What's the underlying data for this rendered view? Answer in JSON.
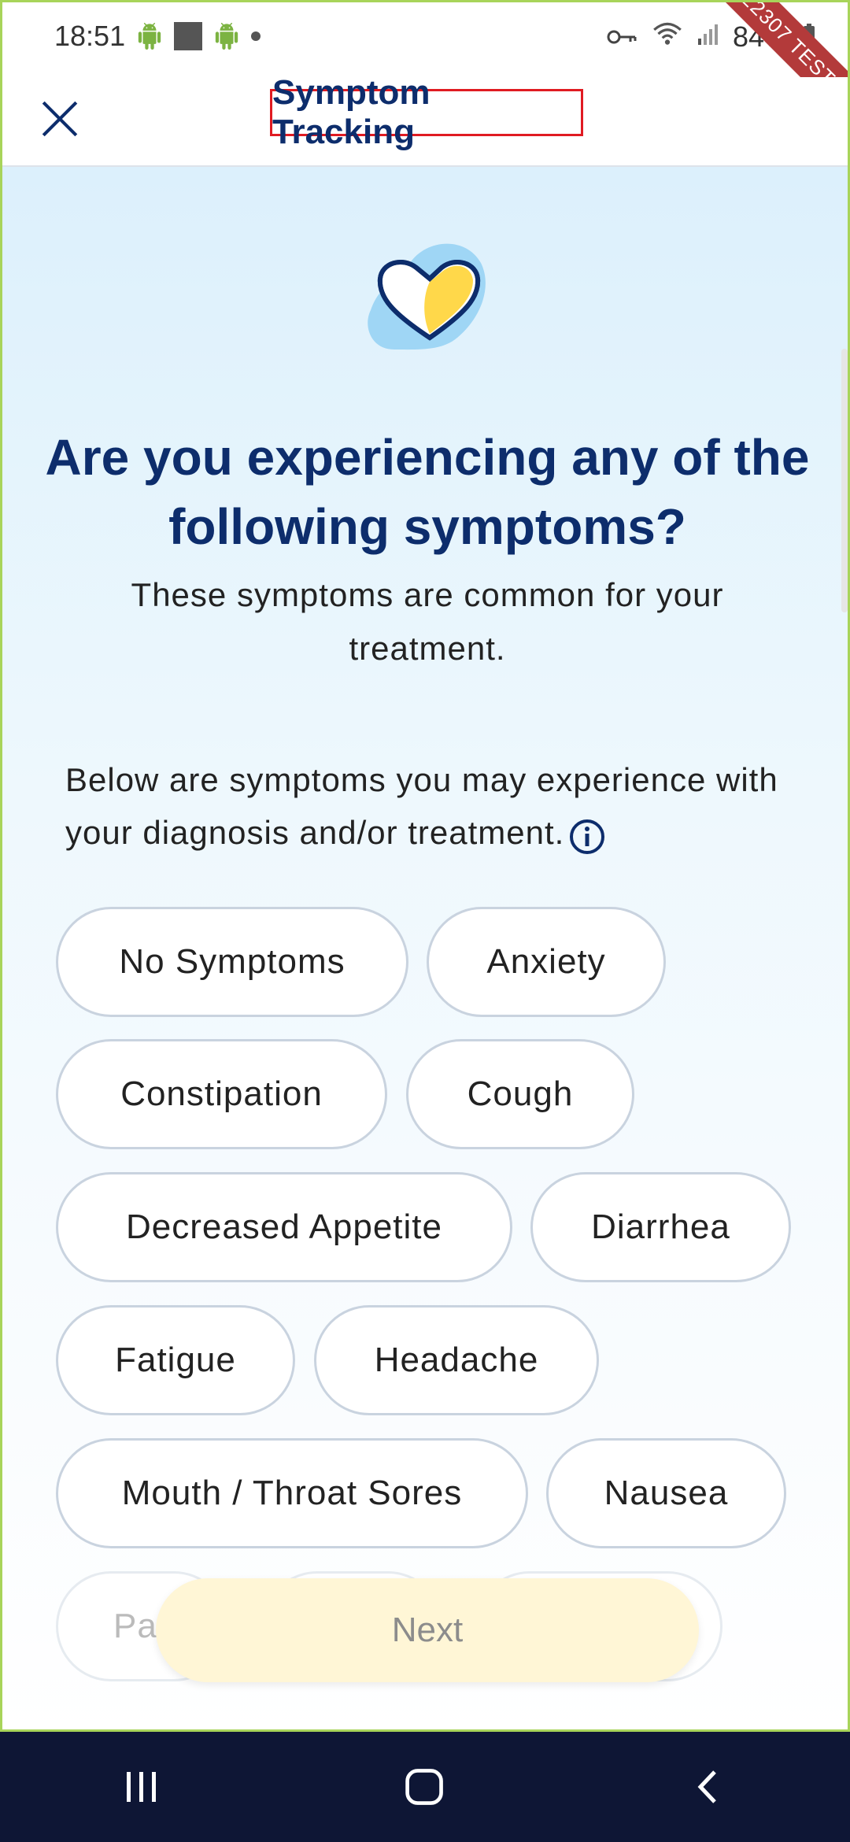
{
  "status_bar": {
    "time": "18:51",
    "battery": "84%",
    "icons": [
      "android-icon",
      "square-icon",
      "android-icon",
      "dot-icon",
      "key-icon",
      "wifi-icon",
      "signal-icon",
      "battery-icon"
    ]
  },
  "debug_banner": "22307 TEST",
  "header": {
    "title": "Symptom Tracking",
    "close_icon": "close-icon"
  },
  "main": {
    "hero_icon": "heart-icon",
    "title": "Are you experiencing any of the following symptoms?",
    "subtitle": "These symptoms are common for your treatment.",
    "intro": "Below are symptoms you may experience with your diagnosis and/or treatment.",
    "info_icon": "info-icon",
    "chips": [
      "No Symptoms",
      "Anxiety",
      "Constipation",
      "Cough",
      "Decreased Appetite",
      "Diarrhea",
      "Fatigue",
      "Headache",
      "Mouth / Throat Sores",
      "Nausea",
      "Pai"
    ]
  },
  "next_button": "Next",
  "colors": {
    "title": "#0d2d6c",
    "chip_border": "#c9d3df",
    "next_bg": "#fff6d6",
    "nav_bg": "#0e1635",
    "highlight_box": "#e01b22"
  },
  "nav_bar": {
    "buttons": [
      "recents-icon",
      "home-icon",
      "back-icon"
    ]
  }
}
